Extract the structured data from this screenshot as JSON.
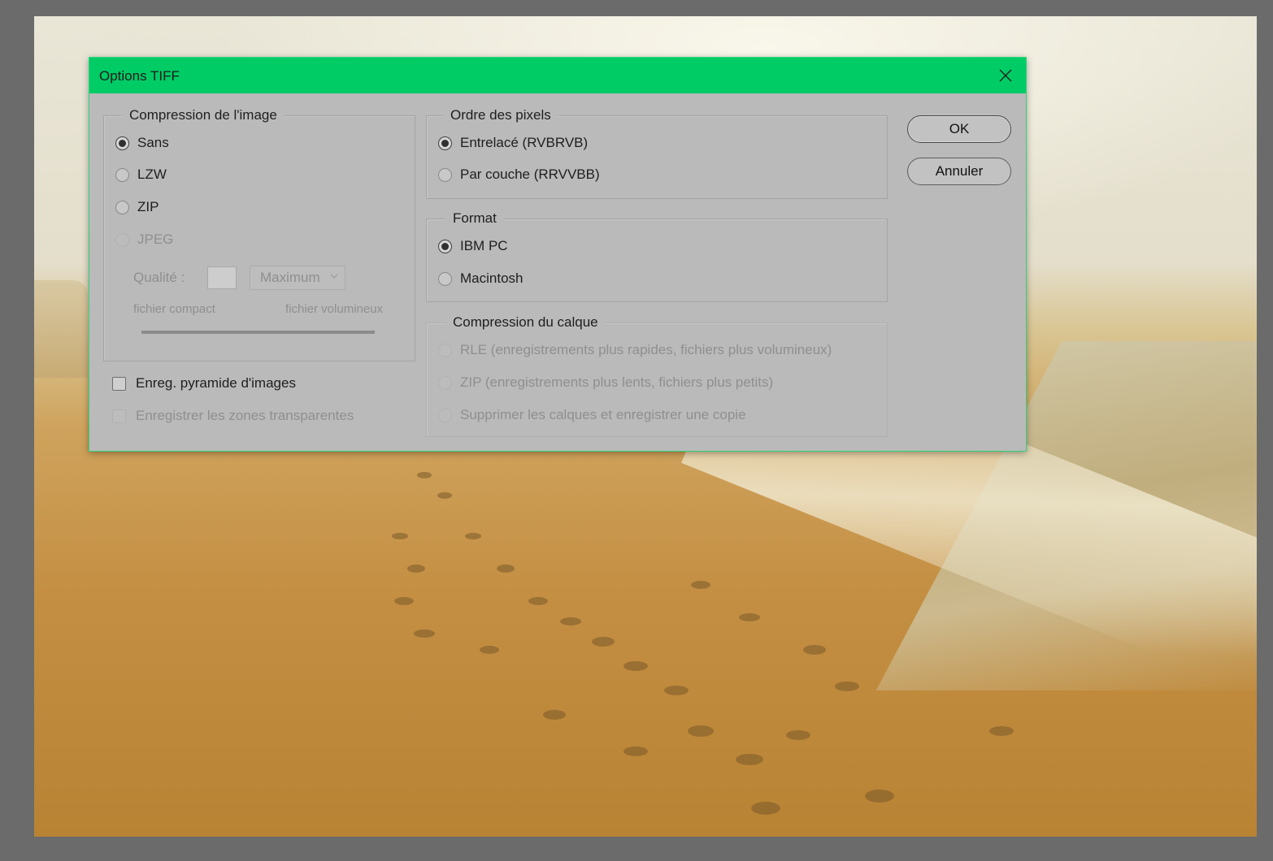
{
  "dialog": {
    "title": "Options TIFF",
    "ok_label": "OK",
    "cancel_label": "Annuler"
  },
  "image_compression": {
    "legend": "Compression de l'image",
    "options": [
      "Sans",
      "LZW",
      "ZIP",
      "JPEG"
    ],
    "selected": "Sans",
    "disabled": [
      "JPEG"
    ],
    "quality_label": "Qualité :",
    "quality_value": "",
    "quality_preset": "Maximum",
    "slider_min_label": "fichier compact",
    "slider_max_label": "fichier volumineux"
  },
  "checkboxes": {
    "save_pyramid": "Enreg. pyramide d'images",
    "save_pyramid_checked": false,
    "save_transparency": "Enregistrer les zones transparentes",
    "save_transparency_checked": false,
    "save_transparency_disabled": true
  },
  "pixel_order": {
    "legend": "Ordre des pixels",
    "options": [
      "Entrelacé (RVBRVB)",
      "Par couche (RRVVBB)"
    ],
    "selected": "Entrelacé (RVBRVB)"
  },
  "byte_order": {
    "legend": "Format",
    "options": [
      "IBM PC",
      "Macintosh"
    ],
    "selected": "IBM PC"
  },
  "layer_compression": {
    "legend": "Compression du calque",
    "options": [
      "RLE (enregistrements plus rapides, fichiers plus volumineux)",
      "ZIP (enregistrements plus lents, fichiers plus petits)",
      "Supprimer les calques et enregistrer une copie"
    ],
    "disabled": true
  },
  "colors": {
    "titlebar": "#00cc66",
    "dialog_bg": "#bababa",
    "workspace_bg": "#6b6b6b"
  },
  "icons": {
    "close": "close-icon",
    "select_chevron": "chevron-down-icon"
  }
}
